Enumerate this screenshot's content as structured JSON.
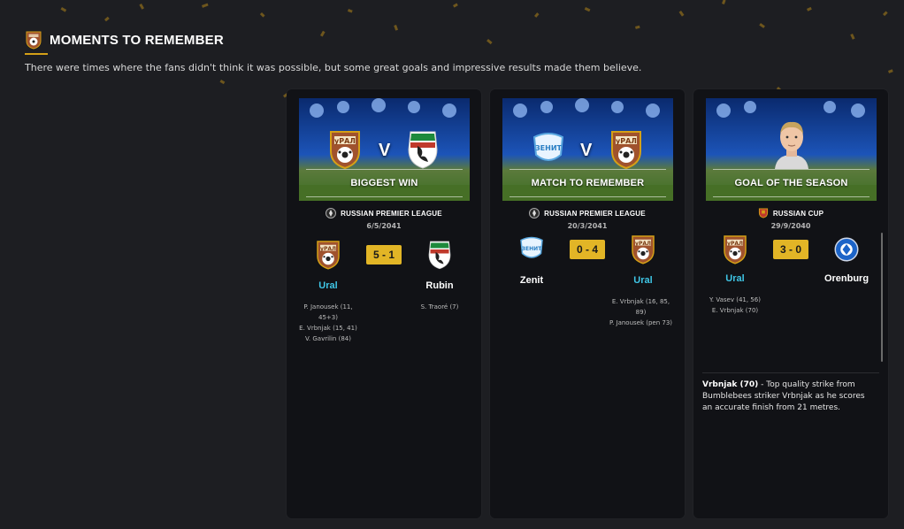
{
  "header": {
    "title": "MOMENTS TO REMEMBER",
    "subtitle": "There were times where the fans didn't think it was possible, but some great goals and impressive results made them believe."
  },
  "colors": {
    "accent": "#e2b526",
    "highlight_team": "#3fc6e6",
    "card_bg": "#111216",
    "page_bg": "#1d1e22"
  },
  "cards": [
    {
      "banner": "BIGGEST WIN",
      "vs": "V",
      "competition": "RUSSIAN PREMIER LEAGUE",
      "date": "6/5/2041",
      "score": "5 - 1",
      "home": {
        "name": "Ural",
        "crest": "ural-crest",
        "scorers": [
          "P. Janousek (11,",
          "45+3)",
          "E. Vrbnjak (15, 41)",
          "V. Gavrilin (84)"
        ]
      },
      "away": {
        "name": "Rubin",
        "crest": "rubin-crest",
        "scorers": [
          "S. Traoré (7)"
        ]
      }
    },
    {
      "banner": "MATCH TO REMEMBER",
      "vs": "V",
      "competition": "RUSSIAN PREMIER LEAGUE",
      "date": "20/3/2041",
      "score": "0 - 4",
      "home": {
        "name": "Zenit",
        "crest": "zenit-crest",
        "scorers": []
      },
      "away": {
        "name": "Ural",
        "crest": "ural-crest",
        "scorers": [
          "E. Vrbnjak (16, 85,",
          "89)",
          "P. Janousek (pen 73)"
        ]
      }
    },
    {
      "banner": "GOAL OF THE SEASON",
      "competition": "RUSSIAN CUP",
      "date": "29/9/2040",
      "score": "3 - 0",
      "home": {
        "name": "Ural",
        "crest": "ural-crest",
        "scorers": [
          "Y. Vasev (41, 56)",
          "E. Vrbnjak (70)"
        ]
      },
      "away": {
        "name": "Orenburg",
        "crest": "orenburg-crest",
        "scorers": []
      },
      "goal": {
        "scorer": "Vrbnjak (70)",
        "description": " - Top quality strike from Bumblebees striker Vrbnjak as he scores an accurate finish from 21 metres."
      }
    }
  ]
}
